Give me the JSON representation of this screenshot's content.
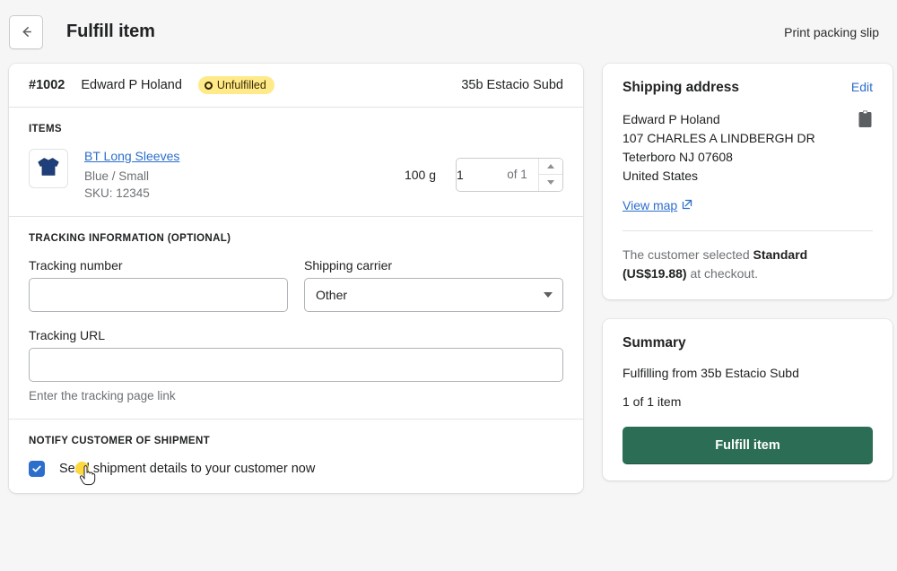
{
  "header": {
    "back_icon": "arrow-left-icon",
    "title": "Fulfill item",
    "print_label": "Print packing slip"
  },
  "order": {
    "number": "#1002",
    "customer": "Edward P Holand",
    "status_badge": "Unfulfilled",
    "badge_color": "#ffea8a",
    "location": "35b Estacio Subd"
  },
  "items_section": {
    "label": "ITEMS",
    "item": {
      "thumbnail_icon": "long-sleeve-shirt-icon",
      "title": "BT Long Sleeves",
      "variant": "Blue / Small",
      "sku": "SKU: 12345",
      "weight": "100 g",
      "quantity": "1",
      "quantity_of": "of 1"
    }
  },
  "tracking_section": {
    "label": "TRACKING INFORMATION (OPTIONAL)",
    "tracking_number_label": "Tracking number",
    "tracking_number_value": "",
    "shipping_carrier_label": "Shipping carrier",
    "shipping_carrier_value": "Other",
    "tracking_url_label": "Tracking URL",
    "tracking_url_value": "",
    "tracking_url_help": "Enter the tracking page link"
  },
  "notify_section": {
    "label": "NOTIFY CUSTOMER OF SHIPMENT",
    "checkbox_checked": true,
    "checkbox_label": "Send shipment details to your customer now"
  },
  "shipping_address": {
    "title": "Shipping address",
    "edit_label": "Edit",
    "copy_icon": "clipboard-icon",
    "lines": [
      "Edward P Holand",
      "107 CHARLES A LINDBERGH DR",
      "Teterboro NJ 07608",
      "United States"
    ],
    "view_map_label": "View map",
    "view_map_icon": "external-link-icon",
    "note_prefix": "The customer selected ",
    "note_method": "Standard (US$19.88)",
    "note_suffix": " at checkout."
  },
  "summary": {
    "title": "Summary",
    "fulfilling_from": "Fulfilling from 35b Estacio Subd",
    "item_count": "1 of 1 item",
    "fulfill_button": "Fulfill item",
    "button_color": "#2c6e55"
  }
}
